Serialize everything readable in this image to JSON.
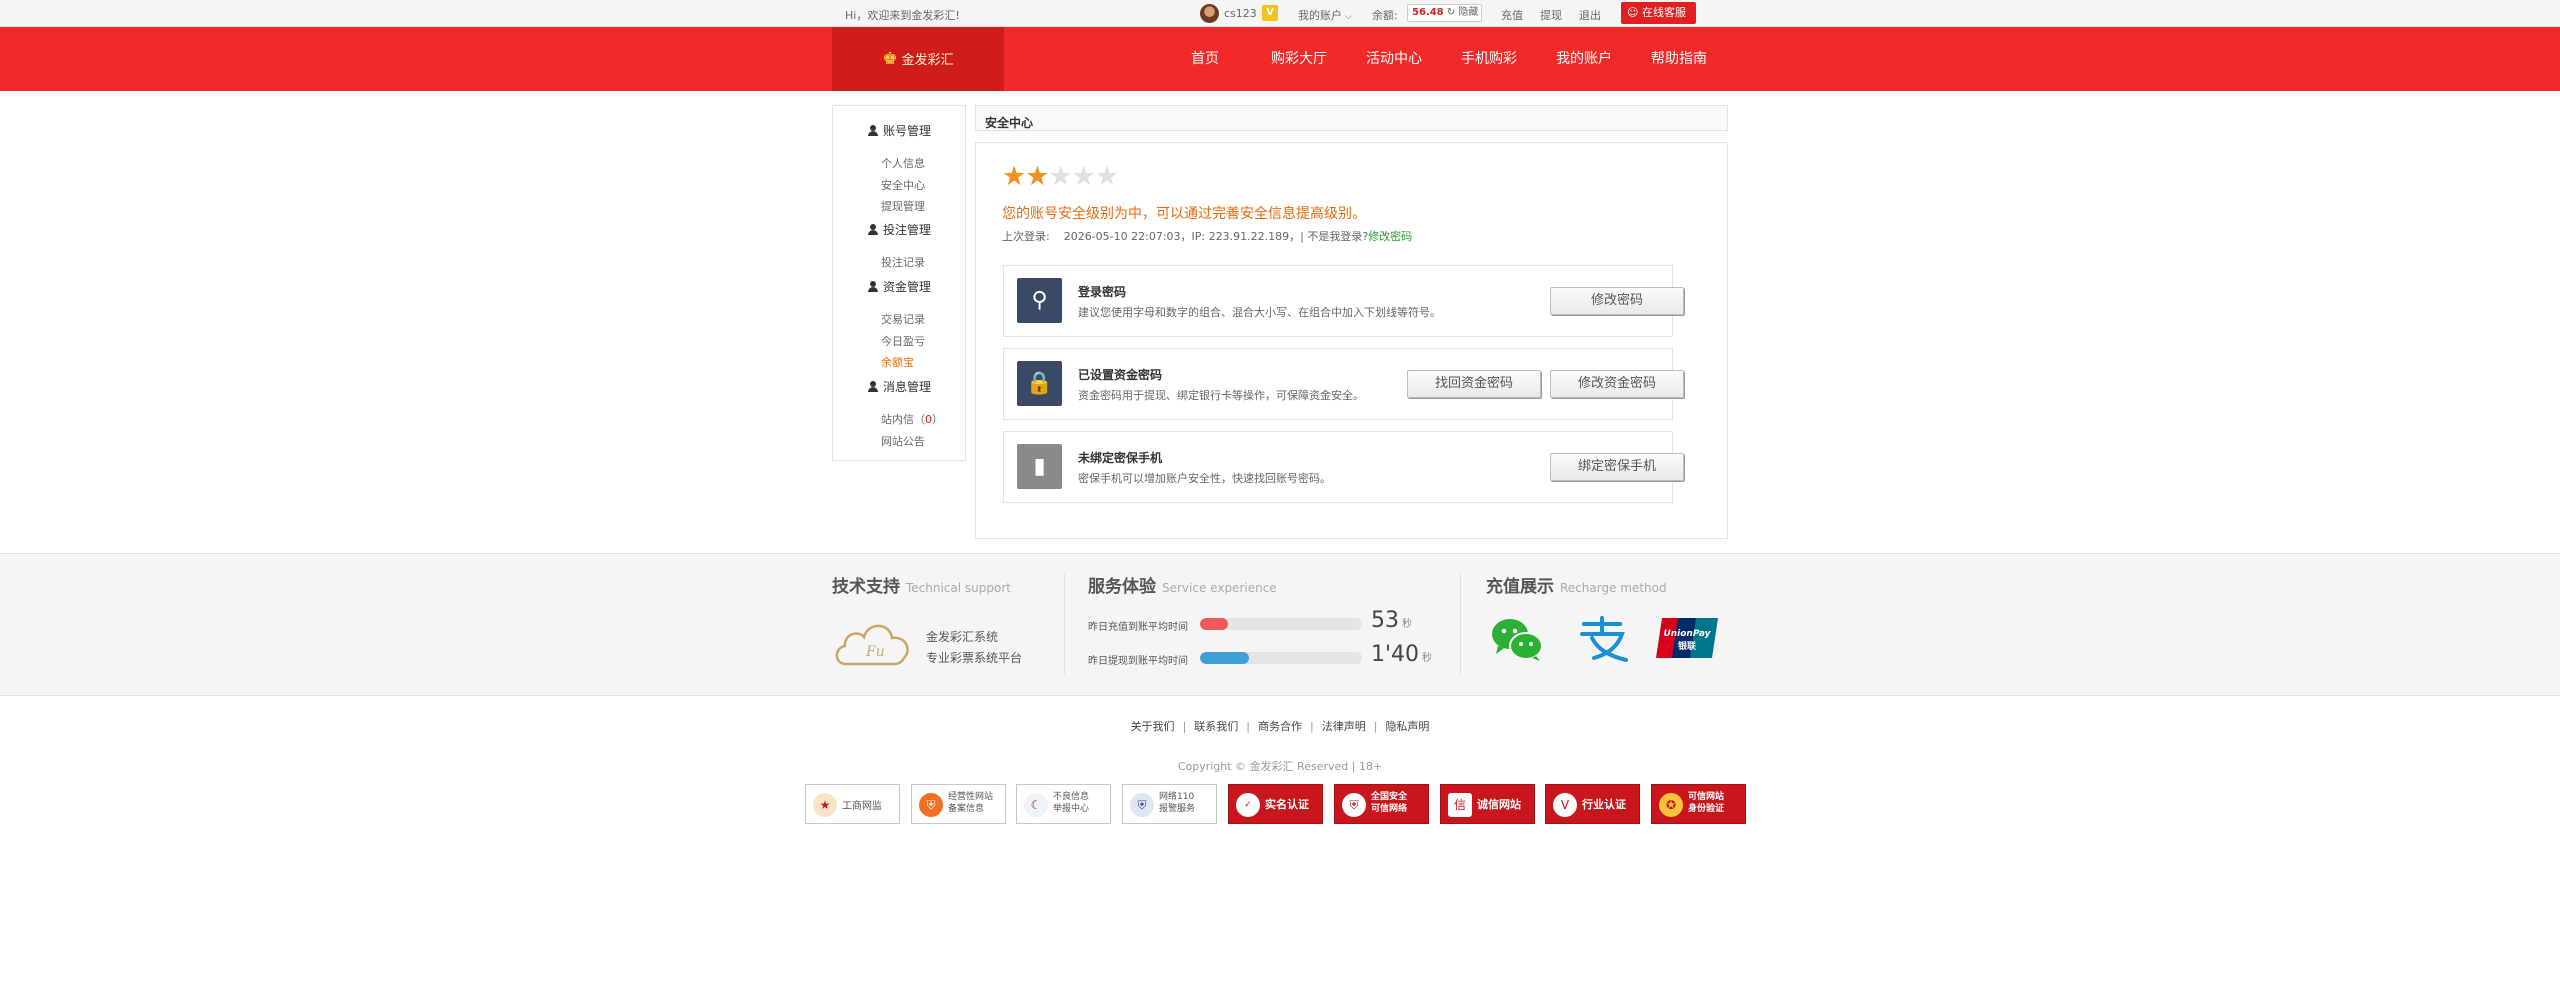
{
  "topbar": {
    "welcome": "Hi，欢迎来到金发彩汇!",
    "username": "cs123",
    "vip": "V",
    "my_account": "我的账户",
    "balance_label": "余额:",
    "balance": "56.48",
    "hide_label": "隐藏",
    "links": [
      "充值",
      "提现",
      "退出"
    ],
    "online_service": "在线客服"
  },
  "nav": {
    "logo": "金发彩汇",
    "items": [
      "首页",
      "购彩大厅",
      "活动中心",
      "手机购彩",
      "我的账户",
      "帮助指南"
    ]
  },
  "sidebar": {
    "groups": [
      {
        "title": "账号管理",
        "items": [
          "个人信息",
          "安全中心",
          "提现管理"
        ]
      },
      {
        "title": "投注管理",
        "items": [
          "投注记录"
        ]
      },
      {
        "title": "资金管理",
        "items": [
          "交易记录",
          "今日盈亏",
          "余额宝"
        ]
      },
      {
        "title": "消息管理",
        "items": [
          "站内信",
          "网站公告"
        ]
      }
    ],
    "message_count": "0",
    "active_item": "余额宝"
  },
  "main": {
    "breadcrumb": "安全中心",
    "rating": {
      "filled": 2,
      "total": 5
    },
    "level_text": "您的账号安全级别为中，可以通过完善安全信息提高级别。",
    "last_login_label": "上次登录:",
    "last_login_time": "2026-05-10 22:07:03",
    "ip_label": "IP:",
    "ip": "223.91.22.189",
    "not_me": "| 不是我登录?",
    "change_password_link": "修改密码",
    "rows": [
      {
        "title": "登录密码",
        "desc": "建议您使用字母和数字的组合、混合大小写、在组合中加入下划线等符号。",
        "buttons": [
          "修改密码"
        ]
      },
      {
        "title": "已设置资金密码",
        "desc": "资金密码用于提现、绑定银行卡等操作，可保障资金安全。",
        "buttons": [
          "找回资金密码",
          "修改资金密码"
        ]
      },
      {
        "title": "未绑定密保手机",
        "desc": "密保手机可以增加账户安全性，快速找回账号密码。",
        "buttons": [
          "绑定密保手机"
        ]
      }
    ]
  },
  "footer": {
    "tech": {
      "title": "技术支持",
      "en": "Technical support",
      "lines": [
        "金发彩汇系统",
        "专业彩票系统平台"
      ]
    },
    "service": {
      "title": "服务体验",
      "en": "Service experience",
      "metrics": [
        {
          "label": "昨日充值到账平均时间",
          "value": "53",
          "unit": "秒",
          "fill_pct": 17,
          "color": "#f0595a"
        },
        {
          "label": "昨日提现到账平均时间",
          "value": "1'40",
          "unit": "秒",
          "fill_pct": 30,
          "color": "#3fa0d8"
        }
      ]
    },
    "recharge": {
      "title": "充值展示",
      "en": "Recharge method",
      "methods": [
        "wechat-pay-icon",
        "alipay-icon",
        "unionpay-icon"
      ],
      "unionpay_text": [
        "UnionPay",
        "银联"
      ]
    },
    "links": [
      "关于我们",
      "联系我们",
      "商务合作",
      "法律声明",
      "隐私声明"
    ],
    "copyright": "Copyright © 金发彩汇 Reserved | 18+",
    "badges": [
      {
        "text": "工商网监",
        "type": "plain"
      },
      {
        "text": "经营性网站",
        "text2": "备案信息",
        "type": "plain2"
      },
      {
        "text": "不良信息",
        "text2": "举报中心",
        "type": "plain2"
      },
      {
        "text": "网络110",
        "text2": "报警服务",
        "type": "plain2"
      },
      {
        "text": "实名认证",
        "type": "red"
      },
      {
        "text": "全国安全",
        "text2": "可信网络",
        "type": "red2"
      },
      {
        "text": "诚信网站",
        "type": "red"
      },
      {
        "text": "行业认证",
        "type": "red"
      },
      {
        "text": "可信网站",
        "text2": "身份验证",
        "type": "red2"
      }
    ]
  }
}
